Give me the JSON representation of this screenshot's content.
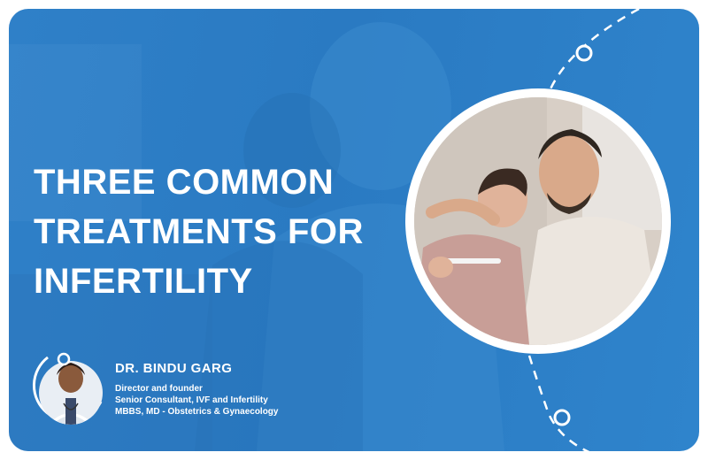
{
  "headline": [
    "THREE COMMON",
    "TREATMENTS FOR",
    "INFERTILITY"
  ],
  "doctor": {
    "name": "DR. BINDU GARG",
    "credentials": [
      "Director and founder",
      "Senior Consultant, IVF and Infertility",
      "MBBS, MD - Obstetrics & Gynaecology"
    ]
  },
  "colors": {
    "background_blue": "#2f80c8",
    "text": "#ffffff",
    "ring": "#ffffff"
  },
  "icons": [
    "dashed-arc-decoration",
    "ring-dot-icon",
    "doctor-avatar",
    "couple-photo"
  ]
}
